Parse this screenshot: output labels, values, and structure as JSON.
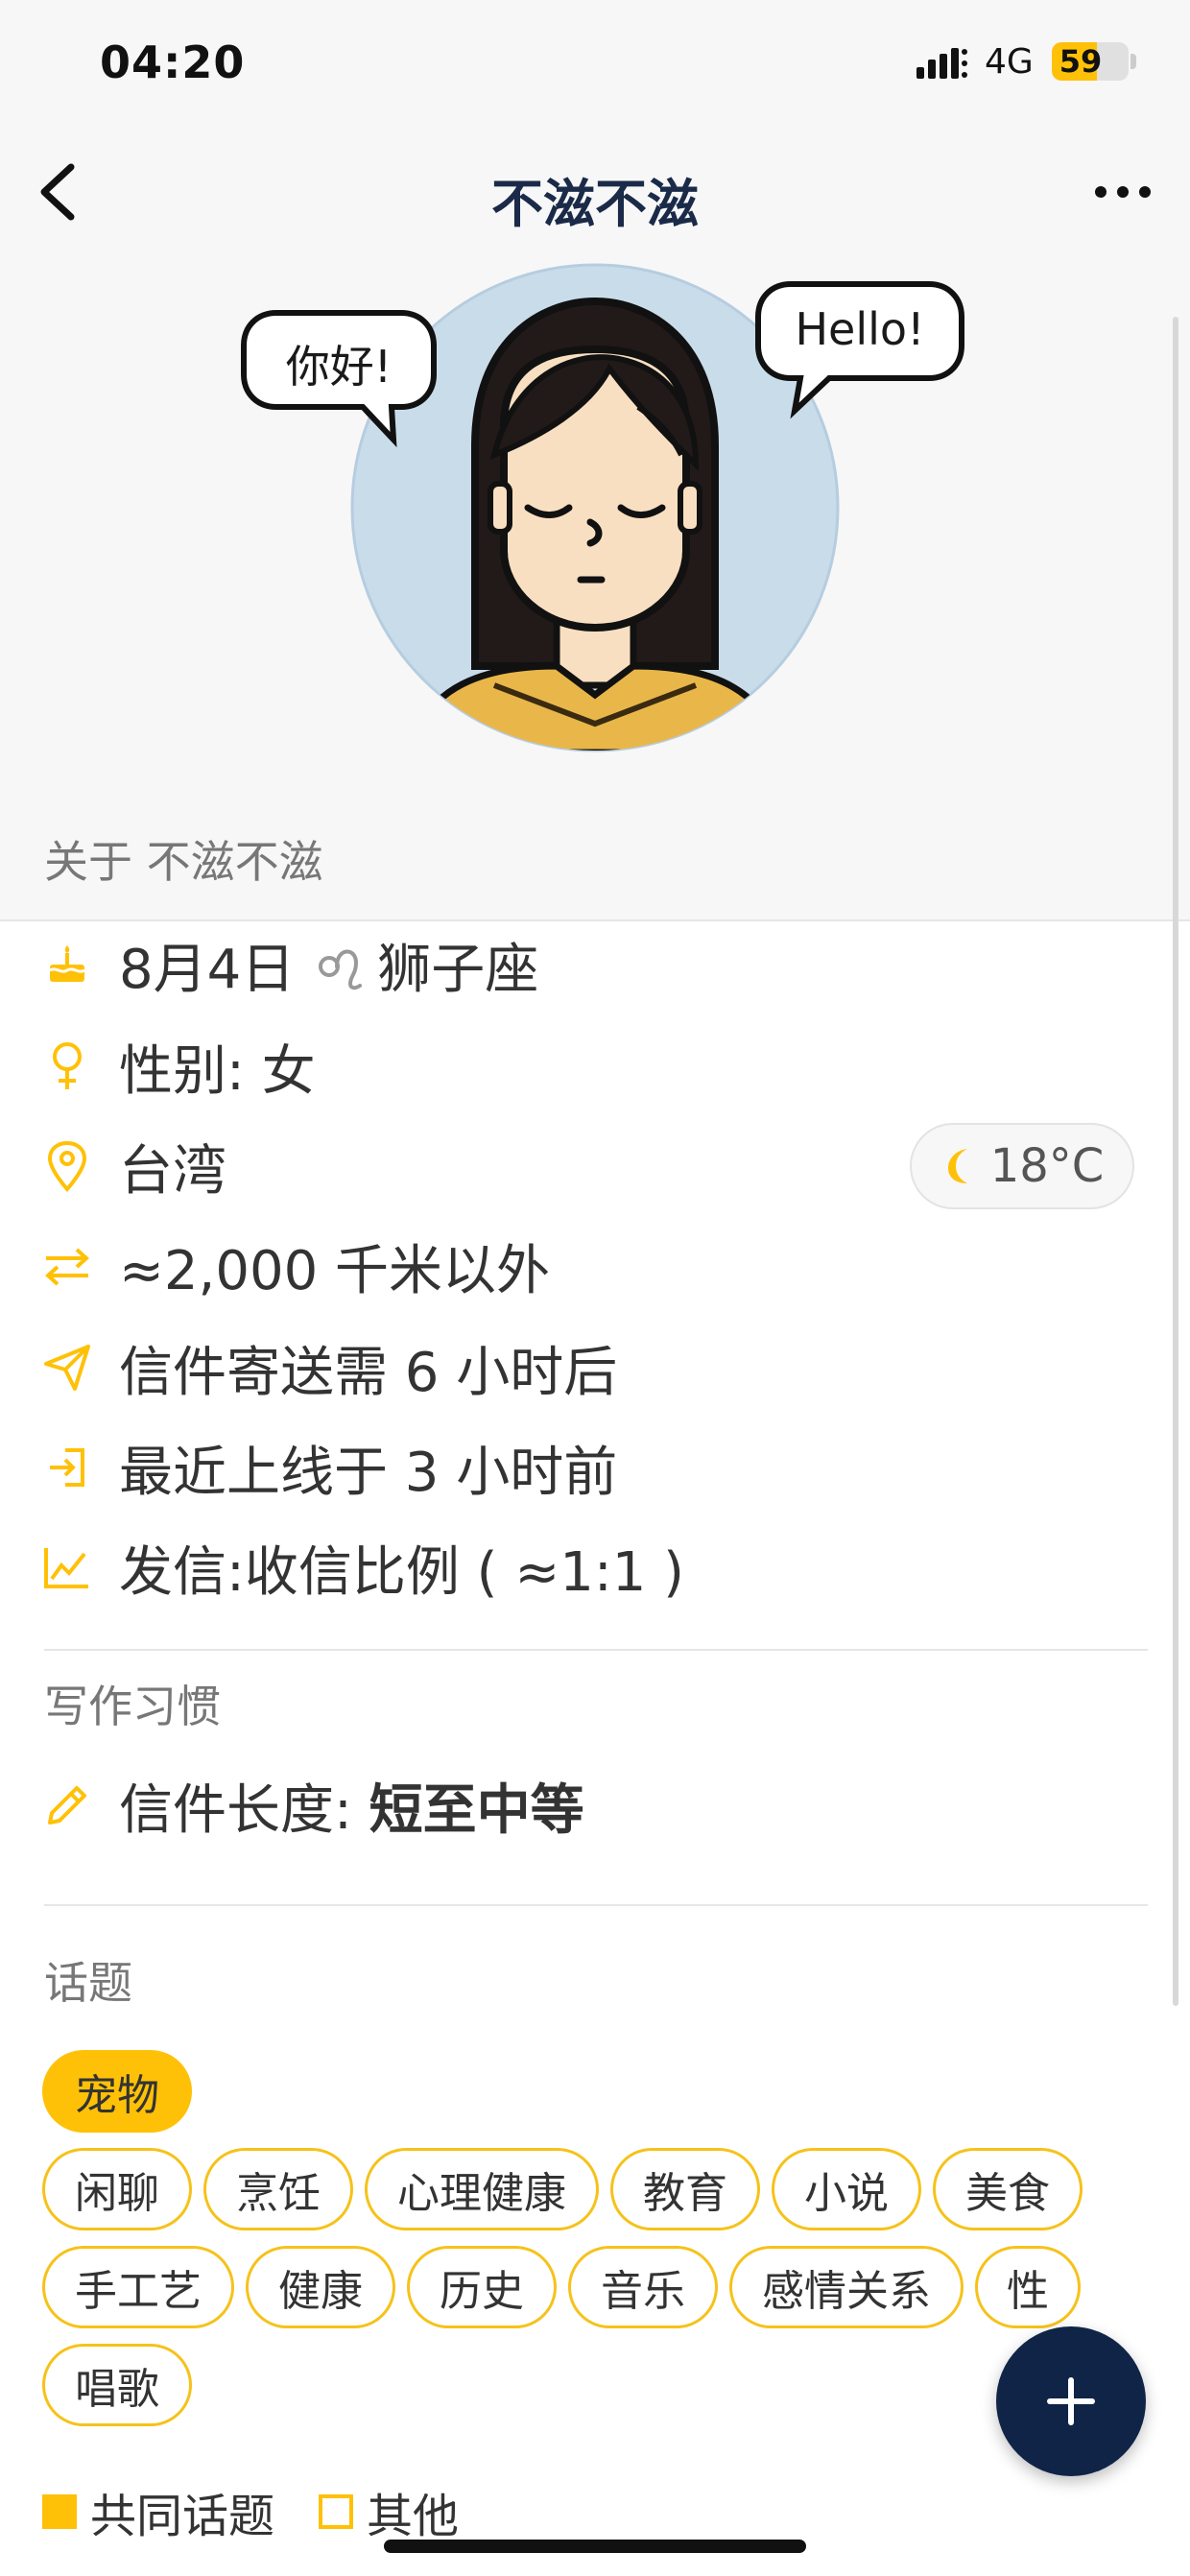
{
  "status_bar": {
    "time": "04:20",
    "network": "4G",
    "battery_level": "59",
    "battery_fraction": 0.59
  },
  "header": {
    "title": "不滋不滋"
  },
  "avatar": {
    "bubble_left": "你好!",
    "bubble_right": "Hello!"
  },
  "about": {
    "title": "关于 不滋不滋",
    "birthday": "8月4日",
    "zodiac": "狮子座",
    "gender": "性别: 女",
    "location": "台湾",
    "weather_temp": "18°C",
    "distance": "≈2,000 千米以外",
    "delivery": "信件寄送需 6 小时后",
    "last_online": "最近上线于 3 小时前",
    "ratio": "发信:收信比例 ( ≈1:1 )"
  },
  "writing": {
    "title": "写作习惯",
    "length_label": "信件长度: ",
    "length_value": "短至中等"
  },
  "topics": {
    "title": "话题",
    "items": [
      {
        "label": "宠物",
        "common": true
      },
      {
        "label": "闲聊",
        "common": false
      },
      {
        "label": "烹饪",
        "common": false
      },
      {
        "label": "心理健康",
        "common": false
      },
      {
        "label": "教育",
        "common": false
      },
      {
        "label": "小说",
        "common": false
      },
      {
        "label": "美食",
        "common": false
      },
      {
        "label": "手工艺",
        "common": false
      },
      {
        "label": "健康",
        "common": false
      },
      {
        "label": "历史",
        "common": false
      },
      {
        "label": "音乐",
        "common": false
      },
      {
        "label": "感情关系",
        "common": false
      },
      {
        "label": "性",
        "common": false
      },
      {
        "label": "唱歌",
        "common": false
      }
    ],
    "legend_common": "共同话题",
    "legend_other": "其他"
  },
  "colors": {
    "accent": "#ffc107",
    "navy": "#0f2447",
    "header_bg": "#f7f7f7"
  },
  "icons": [
    "back-arrow-icon",
    "more-dots-icon",
    "cake-icon",
    "leo-icon",
    "female-icon",
    "location-pin-icon",
    "moon-icon",
    "swap-arrows-icon",
    "send-icon",
    "login-icon",
    "chart-icon",
    "pencil-icon",
    "plus-icon"
  ]
}
